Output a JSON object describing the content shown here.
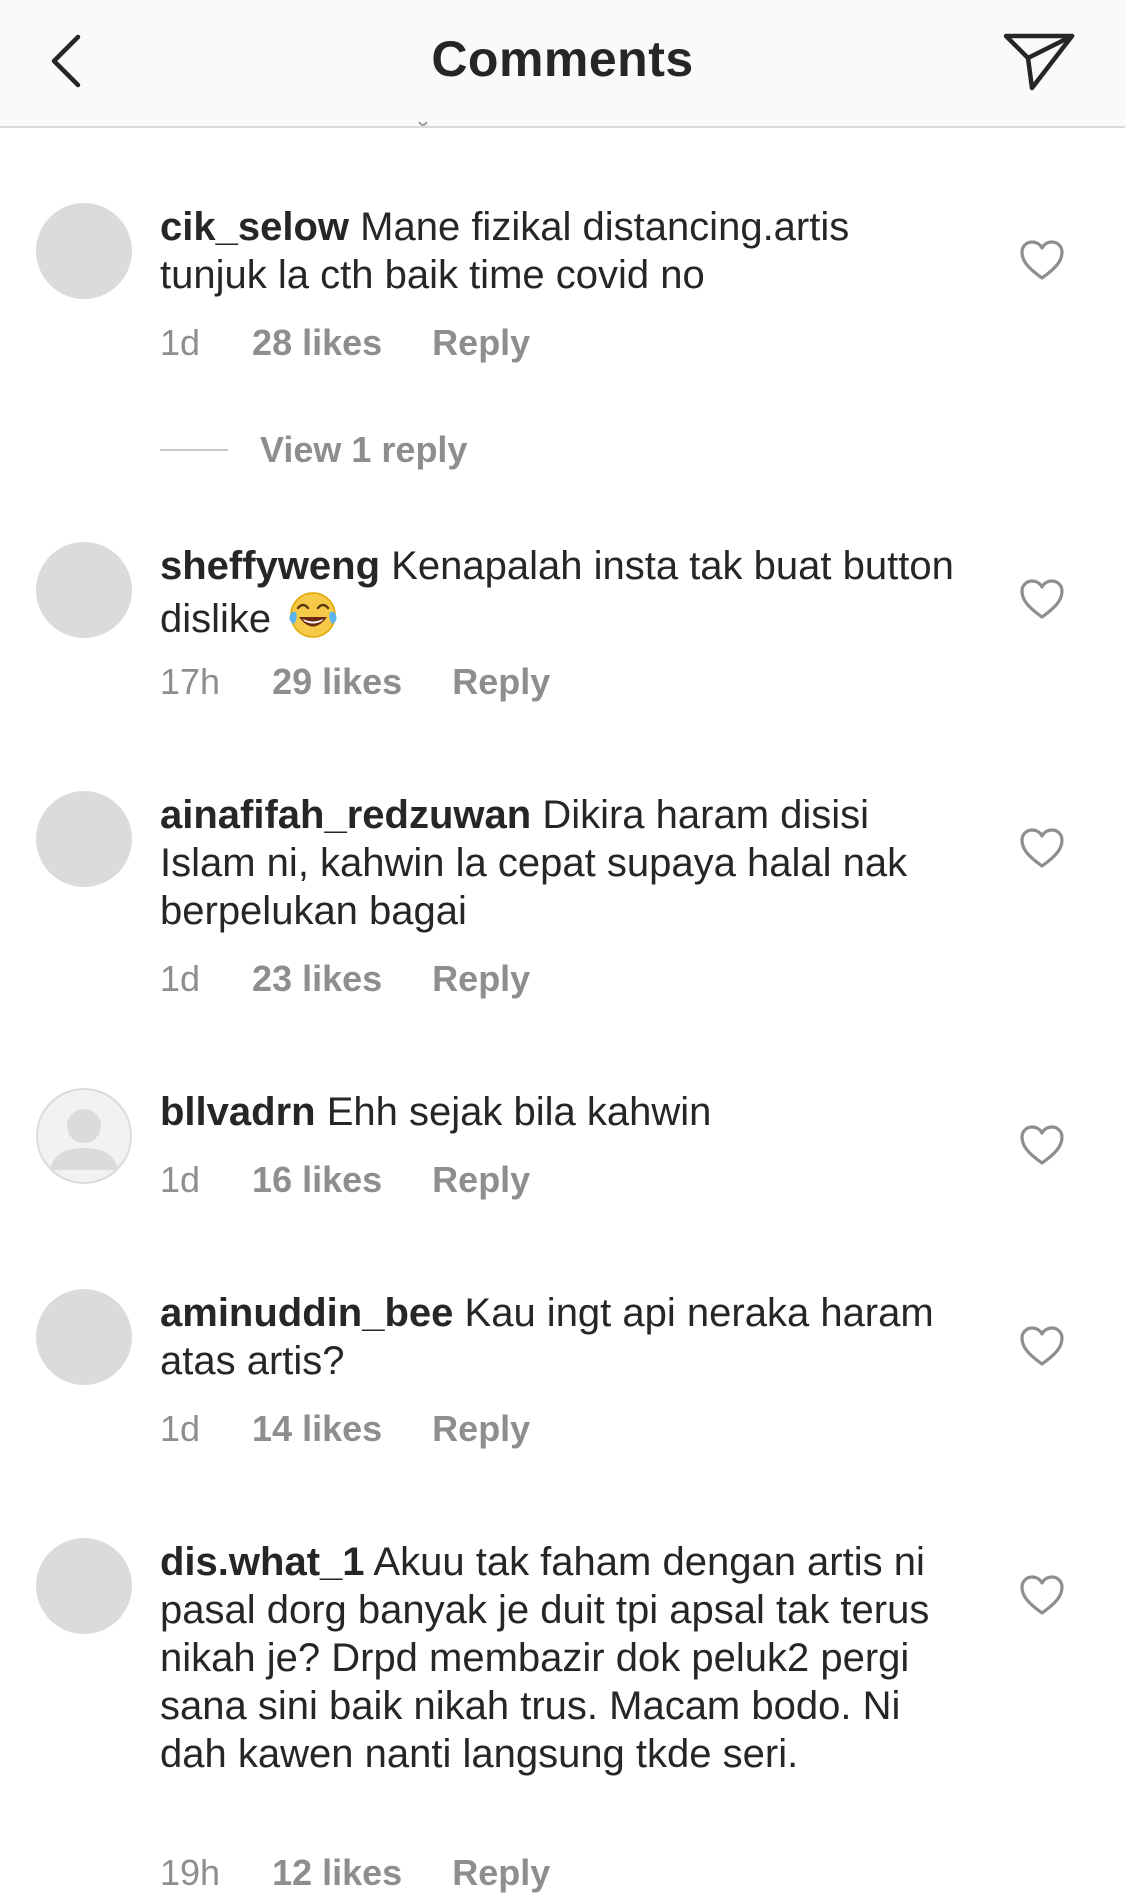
{
  "header": {
    "title": "Comments"
  },
  "comments": [
    {
      "username": "cik_selow",
      "text": "Mane fizikal distancing.artis tunjuk la cth baik time covid no",
      "time": "1d",
      "likes": "28 likes",
      "reply": "Reply",
      "view_replies": "View 1 reply"
    },
    {
      "username": "sheffyweng",
      "text": "Kenapalah insta tak buat button dislike",
      "emoji": "face-with-tears-of-joy",
      "time": "17h",
      "likes": "29 likes",
      "reply": "Reply"
    },
    {
      "username": "ainafifah_redzuwan",
      "text": "Dikira haram disisi Islam ni, kahwin la cepat supaya halal nak berpelukan bagai",
      "time": "1d",
      "likes": "23 likes",
      "reply": "Reply"
    },
    {
      "username": "bllvadrn",
      "text": "Ehh sejak bila kahwin",
      "time": "1d",
      "likes": "16 likes",
      "reply": "Reply"
    },
    {
      "username": "aminuddin_bee",
      "text": "Kau ingt api neraka haram atas artis?",
      "time": "1d",
      "likes": "14 likes",
      "reply": "Reply"
    },
    {
      "username": "dis.what_1",
      "text": "Akuu tak faham dengan artis ni pasal dorg banyak je duit tpi apsal tak terus nikah je? Drpd membazir dok peluk2 pergi sana sini baik nikah trus. Macam bodo. Ni dah kawen nanti langsung tkde seri.",
      "time": "19h",
      "likes": "12 likes",
      "reply": "Reply"
    }
  ],
  "colors": {
    "text": "#262626",
    "secondary": "#8e8e8e",
    "avatar_placeholder": "#dbdbdb",
    "header_bg": "#fafafa"
  }
}
